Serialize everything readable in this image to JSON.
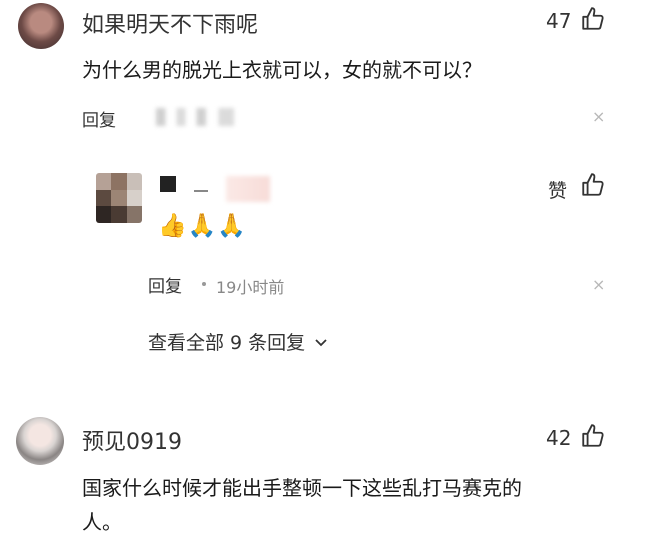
{
  "comments": [
    {
      "username": "如果明天不下雨呢",
      "text": "为什么男的脱光上衣就可以，女的就不可以？",
      "reply_label": "回复",
      "likes": "47",
      "close_glyph": "×"
    },
    {
      "username": "预见0919",
      "text_line1": "国家什么时候才能出手整顿一下这些乱打马赛克的",
      "text_line2": "人。",
      "likes": "42"
    }
  ],
  "nested_reply": {
    "emoji": "👍🙏🙏",
    "like_label": "赞",
    "reply_label": "回复",
    "time": "19小时前",
    "close_glyph": "×"
  },
  "view_all_replies": {
    "label": "查看全部 9 条回复",
    "chevron": "⌄"
  },
  "colors": {
    "text": "#1a1a1a",
    "muted": "#888888",
    "icon": "#333333"
  },
  "icons": [
    "thumbs-up-icon",
    "close-icon",
    "chevron-down-icon"
  ]
}
